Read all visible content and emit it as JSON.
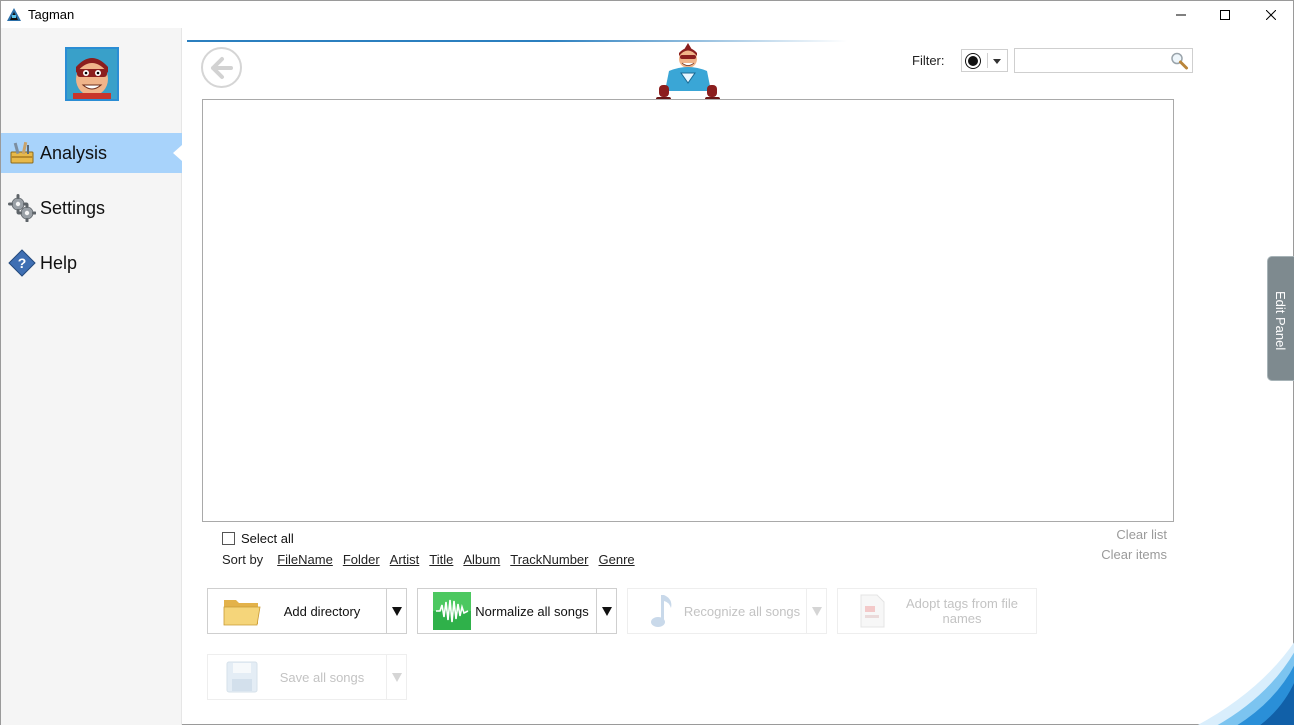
{
  "window": {
    "title": "Tagman"
  },
  "sidebar": {
    "items": [
      {
        "label": "Analysis",
        "icon": "toolbox-icon",
        "active": true
      },
      {
        "label": "Settings",
        "icon": "gear-icon",
        "active": false
      },
      {
        "label": "Help",
        "icon": "help-icon",
        "active": false
      }
    ]
  },
  "filter": {
    "label": "Filter:",
    "value": ""
  },
  "list": {
    "select_all_label": "Select all",
    "sort_label": "Sort by",
    "sort_options": [
      "FileName",
      "Folder",
      "Artist",
      "Title",
      "Album",
      "TrackNumber",
      "Genre"
    ],
    "clear_list": "Clear list",
    "clear_items": "Clear items"
  },
  "actions": {
    "add_directory": "Add directory",
    "normalize_all": "Normalize all songs",
    "recognize_all": "Recognize all songs",
    "adopt_tags": "Adopt tags from file names",
    "save_all": "Save all songs"
  },
  "edit_panel": {
    "label": "Edit Panel"
  },
  "colors": {
    "accent": "#2b7fbf",
    "active_nav": "#a8d3fb",
    "edit_panel": "#7e8a8f"
  }
}
